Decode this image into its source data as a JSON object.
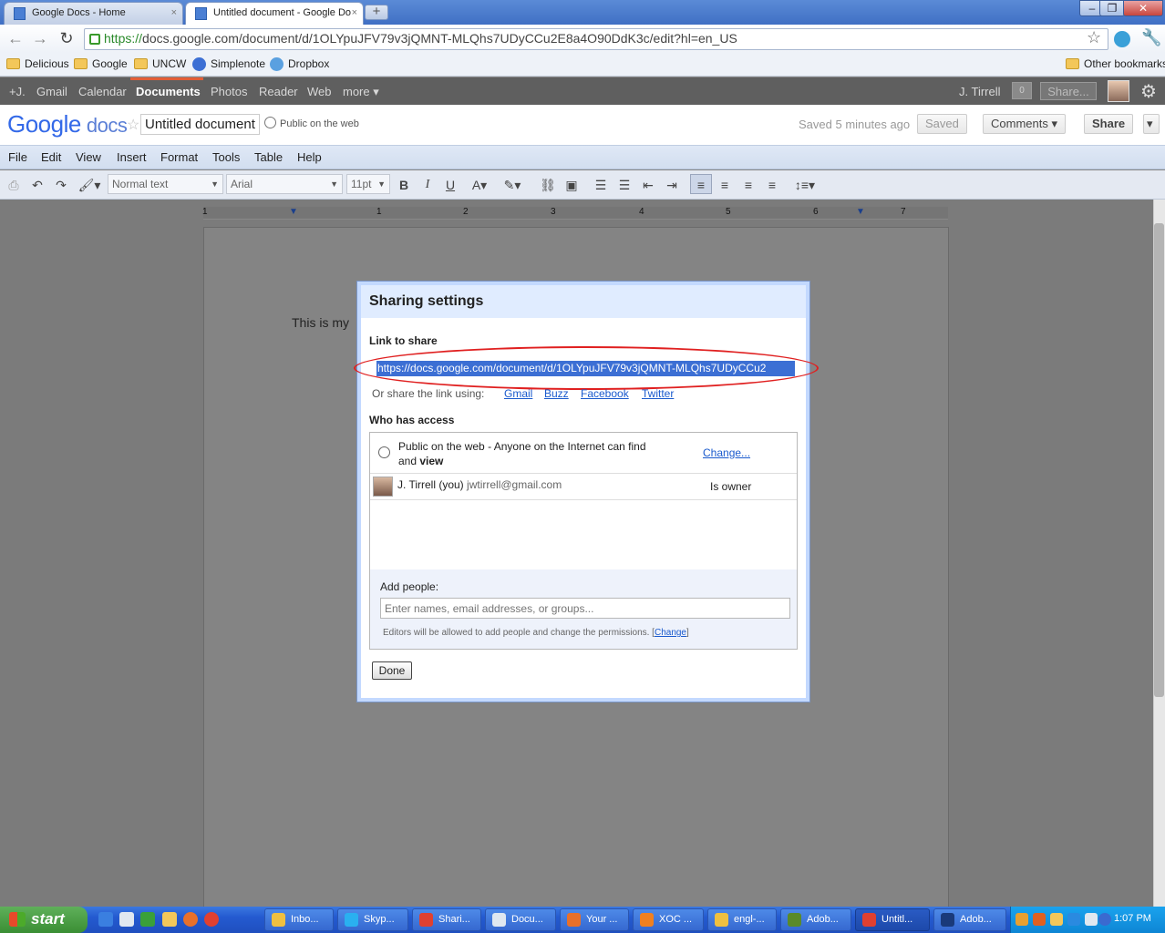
{
  "browser": {
    "tabs": [
      {
        "label": "Google Docs - Home",
        "close": "×"
      },
      {
        "label": "Untitled document - Google Do",
        "close": "×"
      }
    ],
    "new_tab": "+",
    "url_scheme": "https://",
    "url_rest": "docs.google.com/document/d/1OLYpuJFV79v3jQMNT-MLQhs7UDyCCu2E8a4O90DdK3c/edit?hl=en_US",
    "bookmarks": [
      "Delicious",
      "Google",
      "UNCW",
      "Simplenote",
      "Dropbox"
    ],
    "other_bookmarks": "Other bookmarks"
  },
  "gbar": {
    "items": [
      "+J.",
      "Gmail",
      "Calendar",
      "Documents",
      "Photos",
      "Reader",
      "Web",
      "more ▾"
    ],
    "user": "J. Tirrell",
    "count": "0",
    "share": "Share..."
  },
  "docs": {
    "logo_google": "Google",
    "logo_docs": "docs",
    "title": "Untitled document",
    "public": "Public on the web",
    "saved_time": "Saved 5 minutes ago",
    "saved_btn": "Saved",
    "comments_btn": "Comments ▾",
    "share_btn": "Share",
    "share_arrow": "▾"
  },
  "menu": [
    "File",
    "Edit",
    "View",
    "Insert",
    "Format",
    "Tools",
    "Table",
    "Help"
  ],
  "toolbar": {
    "style": "Normal text",
    "font": "Arial",
    "size": "11pt"
  },
  "ruler": [
    "1",
    "1",
    "2",
    "3",
    "4",
    "5",
    "6",
    "7"
  ],
  "document": {
    "body_text": "This is my"
  },
  "dialog": {
    "title": "Sharing settings",
    "link_label": "Link to share",
    "link_value": "https://docs.google.com/document/d/1OLYpuJFV79v3jQMNT-MLQhs7UDyCCu2",
    "share_via": "Or share the link using:",
    "share_links": [
      "Gmail",
      "Buzz",
      "Facebook",
      "Twitter"
    ],
    "who_label": "Who has access",
    "public_text_1": "Public on the web - Anyone on the Internet can find",
    "public_text_2": "and",
    "public_text_bold": "view",
    "change": "Change...",
    "owner_name": "J. Tirrell (you)",
    "owner_email": "jwtirrell@gmail.com",
    "owner_role": "Is owner",
    "add_label": "Add people:",
    "add_placeholder": "Enter names, email addresses, or groups...",
    "note": "Editors will be allowed to add people and change the permissions.",
    "note_change": "Change",
    "done": "Done"
  },
  "taskbar": {
    "start": "start",
    "tasks": [
      "Inbo...",
      "Skyp...",
      "Shari...",
      "Docu...",
      "Your ...",
      "XOC ...",
      "engl-...",
      "Adob...",
      "Untitl...",
      "Adob..."
    ],
    "clock": "1:07 PM"
  }
}
